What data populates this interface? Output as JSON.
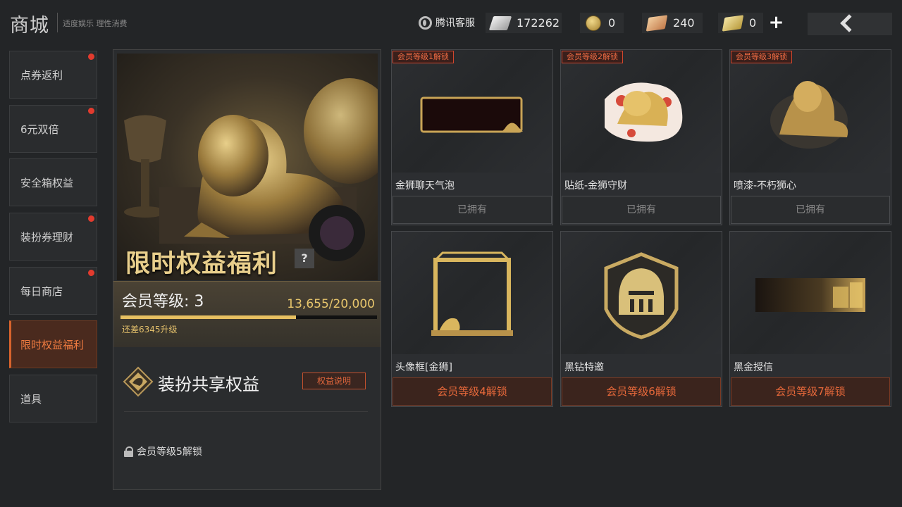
{
  "header": {
    "title": "商城",
    "subtitle": "适度娱乐 理性消费",
    "customer_service": "腾讯客服",
    "currencies": [
      {
        "icon": "ticket-icon",
        "value": "172262"
      },
      {
        "icon": "coin-icon",
        "value": "0"
      },
      {
        "icon": "voucher-icon",
        "value": "240"
      },
      {
        "icon": "gold-voucher-icon",
        "value": "0"
      }
    ],
    "add_label": "+"
  },
  "sidebar": {
    "items": [
      {
        "label": "点券返利",
        "badge": true
      },
      {
        "label": "6元双倍",
        "badge": true
      },
      {
        "label": "安全箱权益",
        "badge": false
      },
      {
        "label": "装扮券理财",
        "badge": true
      },
      {
        "label": "每日商店",
        "badge": true
      },
      {
        "label": "限时权益福利",
        "badge": false,
        "active": true
      },
      {
        "label": "道具",
        "badge": false
      }
    ]
  },
  "feature": {
    "hero_title": "限时权益福利",
    "help_label": "?",
    "level_label": "会员等级: 3",
    "xp_text": "13,655/20,000",
    "xp_progress": 0.683,
    "remain_text": "还差6345升级",
    "share_title": "装扮共享权益",
    "explain_label": "权益说明",
    "lock_text": "会员等级5解锁"
  },
  "items": [
    {
      "tag": "会员等级1解锁",
      "name": "金狮聊天气泡",
      "status": "已拥有",
      "owned": true
    },
    {
      "tag": "会员等级2解锁",
      "name": "贴纸-金狮守财",
      "status": "已拥有",
      "owned": true
    },
    {
      "tag": "会员等级3解锁",
      "name": "喷漆-不朽狮心",
      "status": "已拥有",
      "owned": true
    },
    {
      "tag": "",
      "name": "头像框[金狮]",
      "status": "会员等级4解锁",
      "owned": false
    },
    {
      "tag": "",
      "name": "黑钻特邀",
      "status": "会员等级6解锁",
      "owned": false
    },
    {
      "tag": "",
      "name": "黑金授信",
      "status": "会员等级7解锁",
      "owned": false
    }
  ],
  "colors": {
    "accent": "#e6683a",
    "gold": "#e7c061",
    "badge": "#e23b2e"
  }
}
